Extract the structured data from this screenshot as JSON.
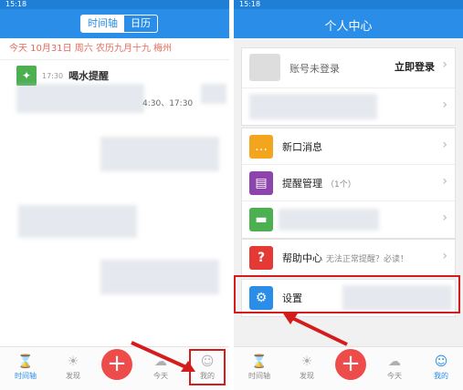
{
  "status_time": "15:18",
  "left": {
    "tabs": [
      "时间轴",
      "日历"
    ],
    "date_line": "今天 10月31日 周六 农历九月十九 梅州",
    "item": {
      "time": "17:30",
      "title": "喝水提醒",
      "times": "4:30、17:30"
    },
    "bottom_nav": [
      "时间轴",
      "发现",
      "今天",
      "我的"
    ]
  },
  "right": {
    "header": "个人中心",
    "profile": {
      "name": "账号未登录",
      "login": "立即登录"
    },
    "rows": [
      {
        "icon": "message-icon",
        "label": "新口消息",
        "sub": ""
      },
      {
        "icon": "clipboard-icon",
        "label": "提醒管理",
        "sub": "（1个）"
      },
      {
        "icon": "folder-icon",
        "label": "",
        "sub": ""
      },
      {
        "icon": "question-icon",
        "label": "帮助中心",
        "sub": "无法正常提醒？必读！"
      },
      {
        "icon": "gear-icon",
        "label": "设置",
        "sub": ""
      }
    ],
    "bottom_nav": [
      "时间轴",
      "发现",
      "今天",
      "我的"
    ]
  },
  "colors": {
    "accent": "#2a8ee9",
    "red": "#d51c1c",
    "plus": "#ee4b4b"
  }
}
